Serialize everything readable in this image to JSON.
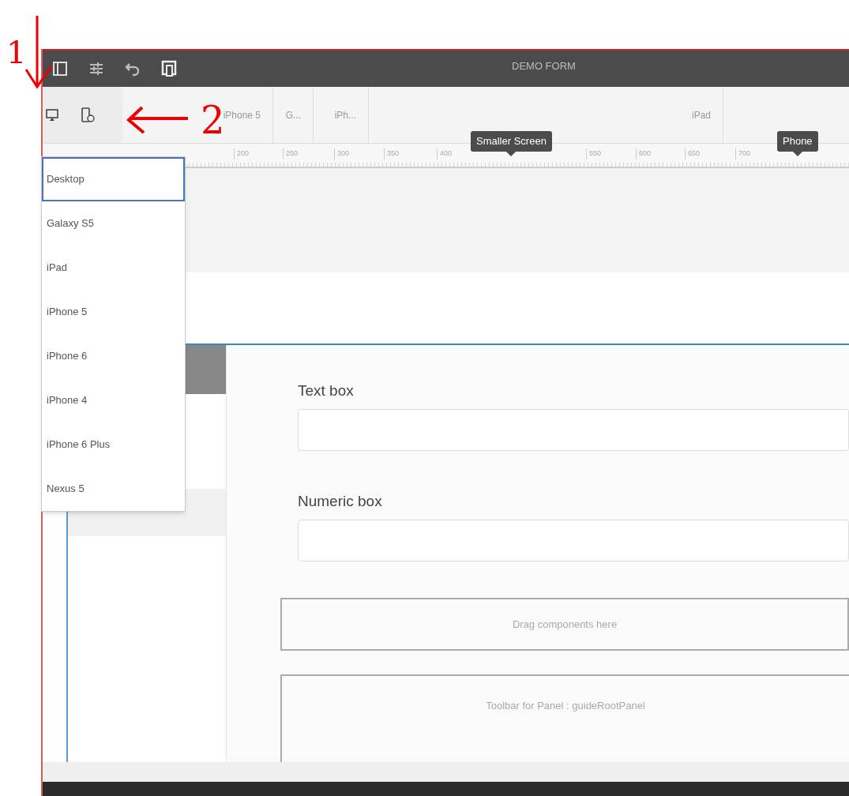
{
  "annotations": [
    {
      "kind": "arrow-down",
      "label": "1"
    },
    {
      "kind": "arrow-left",
      "label": "2"
    }
  ],
  "top_bar": {
    "title": "DEMO FORM"
  },
  "device_tabs": [
    {
      "label": "iPhone 5"
    },
    {
      "label": "G..."
    },
    {
      "label": "iPh..."
    },
    {
      "label": "iPad"
    }
  ],
  "ruler": {
    "ticks": [
      "200",
      "250",
      "300",
      "350",
      "400",
      "550",
      "600",
      "650",
      "700"
    ]
  },
  "tooltips": [
    "Smaller Screen",
    "Phone"
  ],
  "device_menu": [
    {
      "label": "Desktop",
      "selected": true
    },
    {
      "label": "Galaxy S5",
      "selected": false
    },
    {
      "label": "iPad",
      "selected": false
    },
    {
      "label": "iPhone 5",
      "selected": false
    },
    {
      "label": "iPhone 6",
      "selected": false
    },
    {
      "label": "iPhone 4",
      "selected": false
    },
    {
      "label": "iPhone 6 Plus",
      "selected": false
    },
    {
      "label": "Nexus 5",
      "selected": false
    }
  ],
  "form": {
    "fields": [
      {
        "label": "Text box"
      },
      {
        "label": "Numeric box"
      }
    ],
    "drop_zone": "Drag components here",
    "panel_toolbar": "Toolbar for Panel : guideRootPanel"
  }
}
